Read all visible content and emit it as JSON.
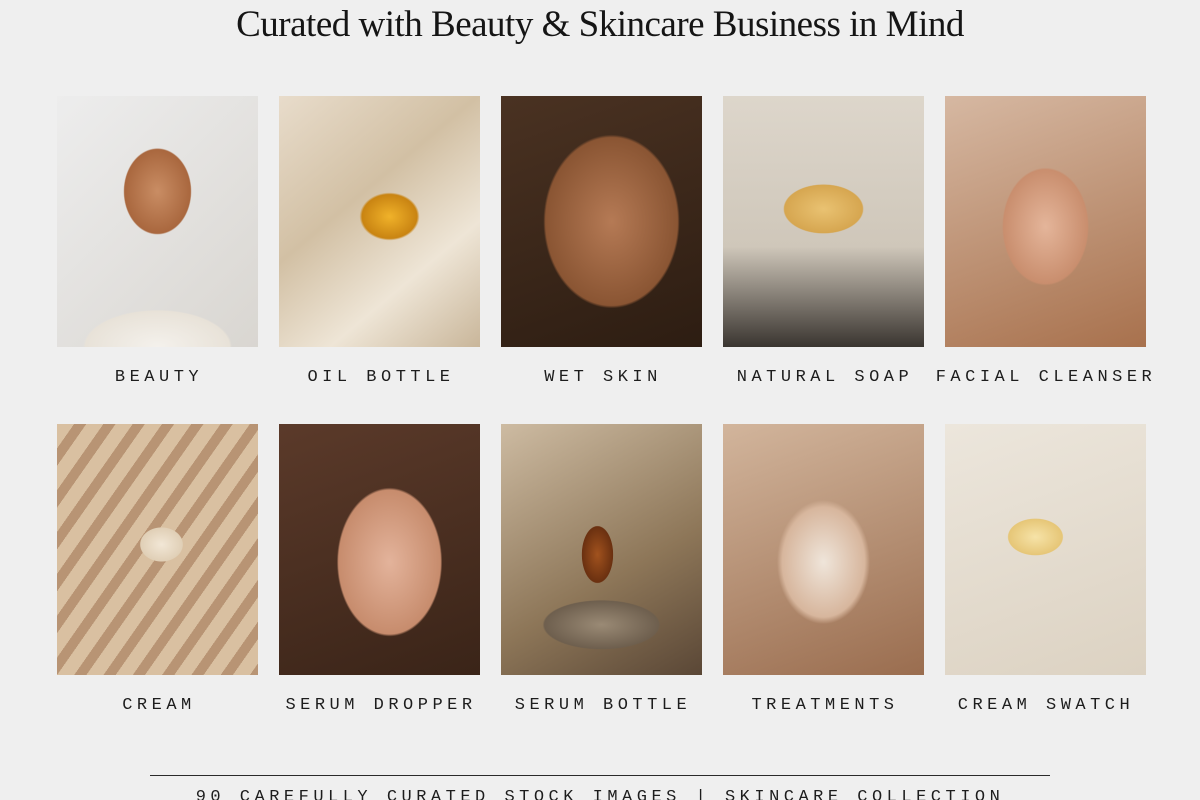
{
  "title": "Curated with Beauty & Skincare Business in Mind",
  "tiles": [
    {
      "label": "BEAUTY"
    },
    {
      "label": "OIL BOTTLE"
    },
    {
      "label": "WET SKIN"
    },
    {
      "label": "NATURAL SOAP"
    },
    {
      "label": "FACIAL CLEANSER"
    },
    {
      "label": "CREAM"
    },
    {
      "label": "SERUM DROPPER"
    },
    {
      "label": "SERUM BOTTLE"
    },
    {
      "label": "TREATMENTS"
    },
    {
      "label": "CREAM SWATCH"
    }
  ],
  "footer": "90 CAREFULLY CURATED STOCK IMAGES | SKINCARE COLLECTION",
  "colors": {
    "background": "#efefef",
    "text": "#1a1a1a"
  }
}
